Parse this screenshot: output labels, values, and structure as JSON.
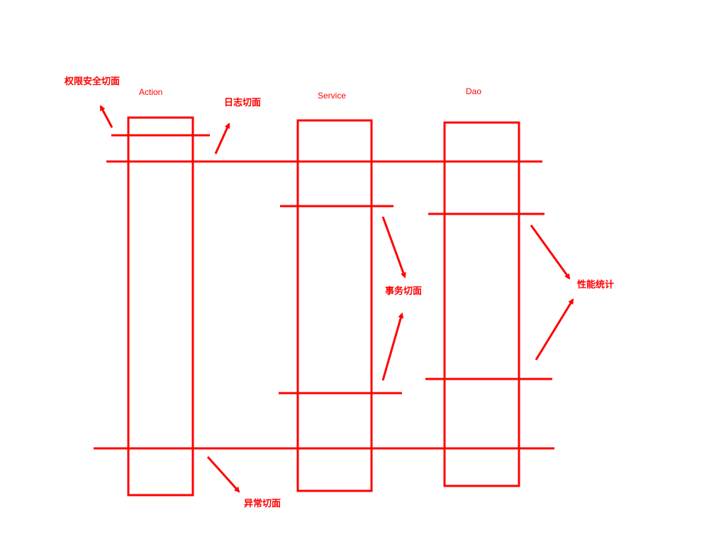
{
  "colors": {
    "stroke": "#ff0000",
    "background": "#ffffff"
  },
  "layers": [
    {
      "id": "action",
      "label": "Action"
    },
    {
      "id": "service",
      "label": "Service"
    },
    {
      "id": "dao",
      "label": "Dao"
    }
  ],
  "aspects": {
    "security": "权限安全切面",
    "logging": "日志切面",
    "transaction": "事务切面",
    "performance": "性能统计",
    "exception": "异常切面"
  }
}
